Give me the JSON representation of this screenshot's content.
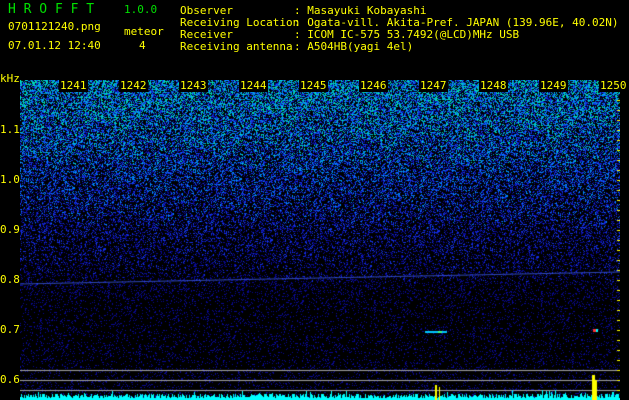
{
  "header": {
    "app_name": "H R O F F T",
    "version": "1.0.0",
    "filename": "0701121240.png",
    "datetime": "07.01.12 12:40",
    "meteor_label": "meteor",
    "meteor_count": "4"
  },
  "info": [
    {
      "label": "Observer",
      "value": "Masayuki Kobayashi"
    },
    {
      "label": "Receiving Location",
      "value": "Ogata-vill. Akita-Pref. JAPAN (139.96E, 40.02N)"
    },
    {
      "label": "Receiver",
      "value": "ICOM IC-575 53.7492(@LCD)MHz USB"
    },
    {
      "label": "Receiving antenna",
      "value": "A504HB(yagi 4el)"
    }
  ],
  "spectrogram": {
    "freq_unit": "kHz",
    "freq_labels": [
      "1.1",
      "1.0",
      "0.9",
      "0.8",
      "0.7",
      "0.6"
    ],
    "time_labels": [
      "1241",
      "1242",
      "1243",
      "1244",
      "1245",
      "1246",
      "1247",
      "1248",
      "1249",
      "1250"
    ],
    "colors": {
      "text": "#ffff00",
      "title": "#00e000",
      "histogram": "#00ffff",
      "meteor_bar": "#ffff00"
    }
  }
}
